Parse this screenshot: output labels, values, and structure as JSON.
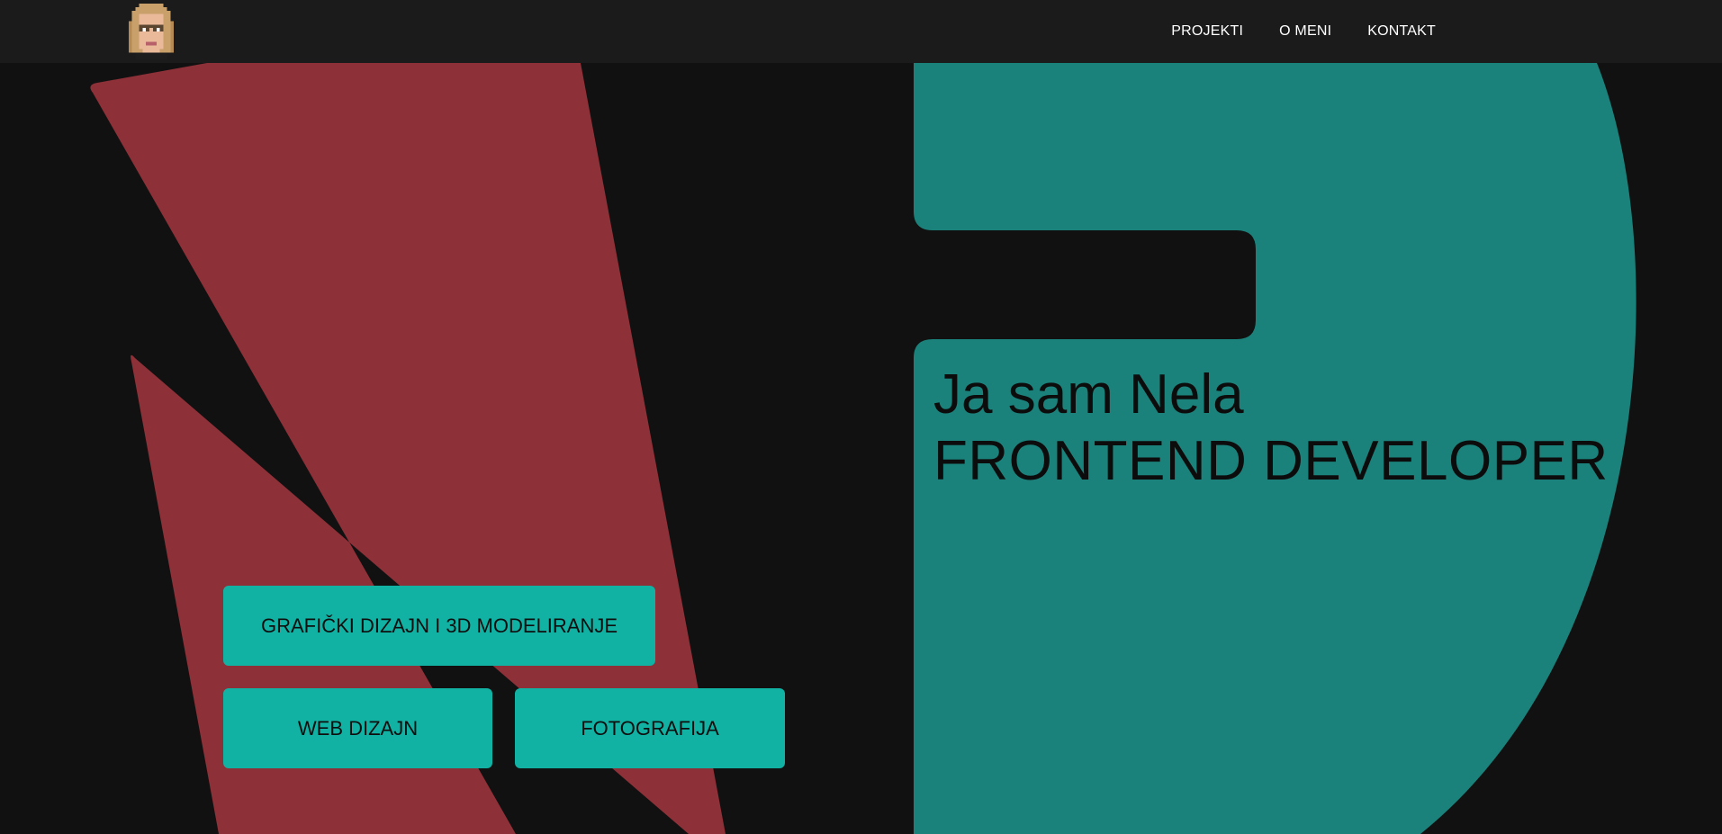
{
  "nav": {
    "logo_icon": "pixel-avatar-icon",
    "links": [
      {
        "label": "PROJEKTI"
      },
      {
        "label": "O MENI"
      },
      {
        "label": "KONTAKT"
      }
    ]
  },
  "hero": {
    "greeting": "Ja sam Nela",
    "role": "FRONTEND DEVELOPER"
  },
  "categories": [
    {
      "label": "GRAFIČKI DIZAJN I 3D MODELIRANJE"
    },
    {
      "label": "WEB DIZAJN"
    },
    {
      "label": "FOTOGRAFIJA"
    }
  ],
  "colors": {
    "background": "#111111",
    "navbar": "#1b1b1b",
    "red_shape": "#8e3038",
    "teal_shape": "#1b827b",
    "button": "#11b1a3"
  }
}
